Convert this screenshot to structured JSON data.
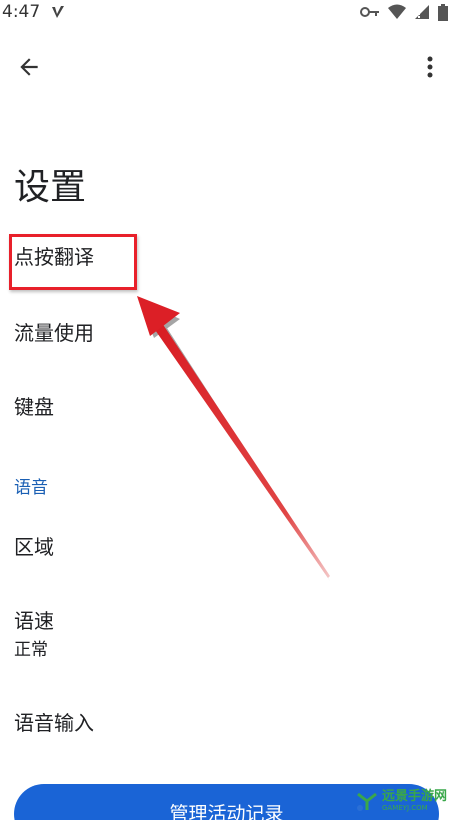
{
  "status_bar": {
    "time": "4:47",
    "icons": [
      "app-v-icon",
      "key-icon",
      "wifi-icon",
      "signal-icon",
      "battery-icon"
    ]
  },
  "app_bar": {
    "back_icon": "arrow-left-icon",
    "more_icon": "more-vertical-icon"
  },
  "page": {
    "title": "设置"
  },
  "settings": {
    "tap_to_translate": "点按翻译",
    "data_usage": "流量使用",
    "keyboard": "键盘",
    "voice_section": "语音",
    "region": "区域",
    "speech_rate": "语速",
    "speech_rate_value": "正常",
    "voice_input": "语音输入"
  },
  "bottom_action": {
    "label": "管理活动记录"
  },
  "watermark": {
    "main": "远景手游网",
    "sub": "GAMEYJ.COM"
  },
  "colors": {
    "accent": "#1a64d6",
    "section": "#1a5fb4",
    "annotation": "#e8202a"
  }
}
